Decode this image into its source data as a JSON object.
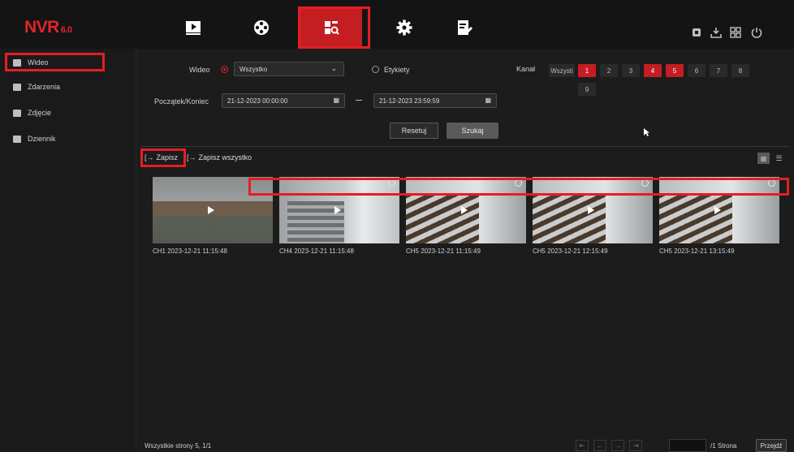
{
  "app": {
    "logo": "NVR",
    "version": "6.0"
  },
  "nav": {
    "items": [
      {
        "name": "playback-nav",
        "icon": "play-icon"
      },
      {
        "name": "smart-nav",
        "icon": "film-reel-icon"
      },
      {
        "name": "search-nav",
        "icon": "file-search-icon",
        "active": true
      },
      {
        "name": "settings-nav",
        "icon": "gear-icon"
      },
      {
        "name": "maintenance-nav",
        "icon": "edit-document-icon"
      }
    ],
    "right_icons": [
      "alarm-icon",
      "download-icon",
      "layout-icon",
      "power-icon"
    ]
  },
  "sidebar": {
    "items": [
      {
        "label": "Wideo",
        "icon": "video-icon",
        "active": true
      },
      {
        "label": "Zdarzenia",
        "icon": "event-icon"
      },
      {
        "label": "Zdjęcie",
        "icon": "photo-icon"
      },
      {
        "label": "Dziennik",
        "icon": "log-icon"
      }
    ]
  },
  "filters": {
    "video_label": "Wideo",
    "video_type_value": "Wszystko",
    "tags_label": "Etykiety",
    "channel_label": "Kanał",
    "channel_all": "Wszysti",
    "channels": [
      "1",
      "2",
      "3",
      "4",
      "5",
      "6",
      "7",
      "8",
      "9"
    ],
    "selected_channels": [
      "1",
      "4",
      "5"
    ],
    "range_label": "Początek/Koniec",
    "start": "21-12-2023 00:00:00",
    "end": "21-12-2023 23:59:59",
    "reset": "Resetuj",
    "search": "Szukaj"
  },
  "toolbar": {
    "save": "Zapisz",
    "save_all": "Zapisz wszystko"
  },
  "results": [
    {
      "caption": "CH1 2023-12-21 11:15:48"
    },
    {
      "caption": "CH4 2023-12-21 11:15:48"
    },
    {
      "caption": "CH5 2023-12-21 11:15:49"
    },
    {
      "caption": "CH5 2023-12-21 12:15:49"
    },
    {
      "caption": "CH5 2023-12-21 13:15:49"
    }
  ],
  "footer": {
    "summary": "Wszystkie strony 5, 1/1",
    "page_suffix": "/1 Strona",
    "goto": "Przejdź"
  },
  "colors": {
    "accent": "#c41d22",
    "highlight": "#e41e25",
    "background": "#1b1b1b"
  }
}
